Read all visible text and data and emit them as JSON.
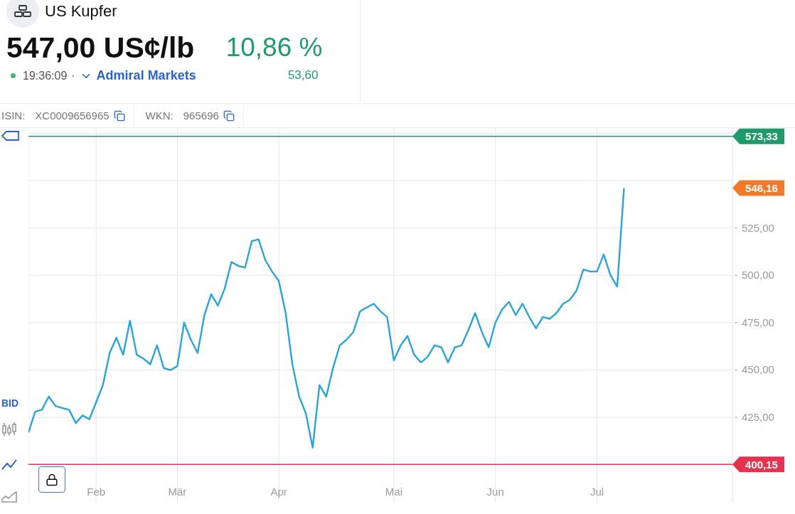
{
  "instrument": {
    "name": "US Kupfer",
    "price": "547,00 US¢/lb",
    "change_percent": "10,86 %",
    "change_abs": "53,60",
    "time": "19:36:09",
    "separator": "·",
    "exchange": "Admiral Markets"
  },
  "identifiers": [
    {
      "label": "ISIN:",
      "value": "XC0009656965"
    },
    {
      "label": "WKN:",
      "value": "965696"
    }
  ],
  "toolbar": {
    "price_type": "BID",
    "chart_types": [
      {
        "kind": "candles",
        "selected": false
      },
      {
        "kind": "line",
        "selected": true
      },
      {
        "kind": "area",
        "selected": false
      }
    ]
  },
  "chart_data": {
    "type": "line",
    "grid": true,
    "ylim": [
      380,
      577
    ],
    "yticks": [
      {
        "value": 425,
        "label": "425,00"
      },
      {
        "value": 450,
        "label": "450,00"
      },
      {
        "value": 475,
        "label": "475,00"
      },
      {
        "value": 500,
        "label": "500,00"
      },
      {
        "value": 525,
        "label": "525,00"
      }
    ],
    "categories": [
      null,
      null,
      null,
      null,
      null,
      null,
      null,
      null,
      null,
      null,
      "Feb",
      null,
      null,
      null,
      null,
      null,
      null,
      null,
      null,
      null,
      null,
      null,
      "Mär",
      null,
      null,
      null,
      null,
      null,
      null,
      null,
      null,
      null,
      null,
      null,
      null,
      null,
      null,
      "Apr",
      null,
      null,
      null,
      null,
      null,
      null,
      null,
      null,
      null,
      null,
      null,
      null,
      null,
      null,
      null,
      null,
      "Mai",
      null,
      null,
      null,
      null,
      null,
      null,
      null,
      null,
      null,
      null,
      null,
      null,
      null,
      null,
      "Jun",
      null,
      null,
      null,
      null,
      null,
      null,
      null,
      null,
      null,
      null,
      null,
      null,
      null,
      null,
      "Jul",
      null,
      null,
      null,
      null
    ],
    "series": [
      {
        "color": "#2ba3d8",
        "values": [
          417,
          428,
          429,
          436,
          431,
          430,
          429,
          422,
          426,
          424,
          433,
          442,
          459,
          467,
          458,
          476,
          458,
          456,
          453,
          463,
          451,
          450,
          452,
          475,
          466,
          459,
          479,
          490,
          484,
          493,
          507,
          505,
          504,
          518,
          519,
          508,
          502,
          497,
          480,
          453,
          436,
          427,
          409,
          442,
          436,
          451,
          463,
          466,
          470,
          481,
          483,
          485,
          481,
          478,
          455,
          463,
          468,
          458,
          454,
          457,
          463,
          462,
          454,
          462,
          463,
          471,
          480,
          470,
          462,
          475,
          482,
          486,
          479,
          485,
          478,
          472,
          478,
          477,
          480,
          485,
          487,
          492,
          503,
          502,
          502,
          511,
          500,
          494,
          546
        ]
      }
    ],
    "ref_lines": [
      {
        "axis": "y",
        "value": 573.33,
        "label": "573,33",
        "color": "#1f9a6b"
      },
      {
        "axis": "y",
        "value": 400.15,
        "label": "400,15",
        "color": "#e5334f"
      }
    ]
  },
  "last_price_tag": "546,16"
}
